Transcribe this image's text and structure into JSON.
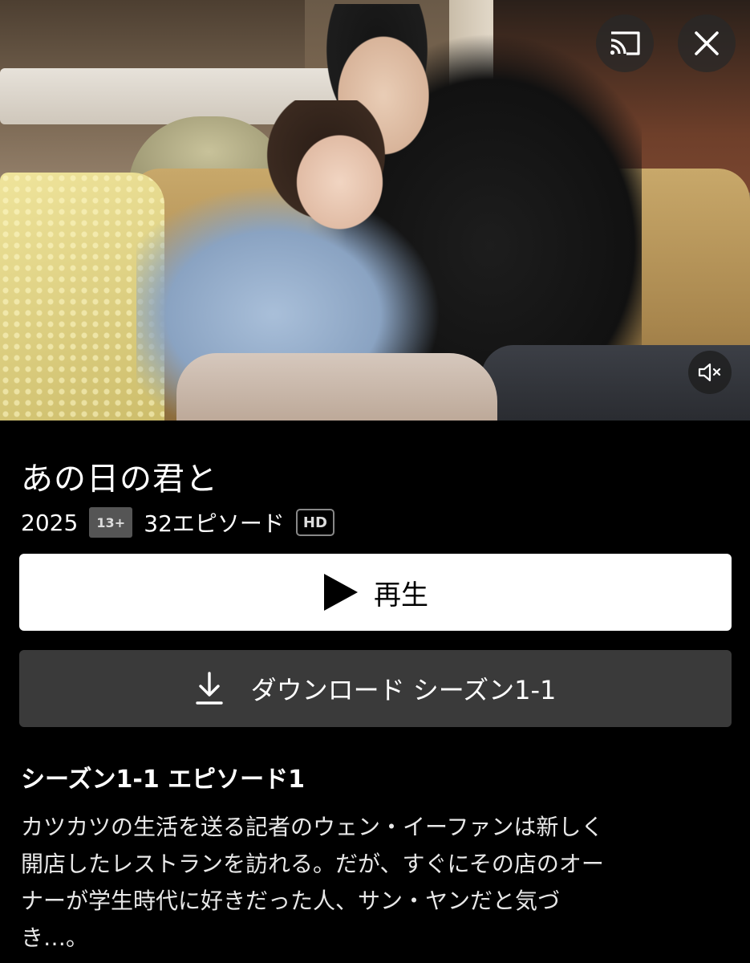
{
  "player": {
    "cast_icon": "cast-icon",
    "close_icon": "close-icon",
    "mute_icon": "muted-speaker-icon"
  },
  "show": {
    "title": "あの日の君と",
    "year": "2025",
    "rating": "13+",
    "episodes": "32エピソード",
    "quality": "HD"
  },
  "actions": {
    "play_label": "再生",
    "play_icon": "play-icon",
    "download_label": "ダウンロード シーズン1-1",
    "download_icon": "download-icon"
  },
  "episode": {
    "title": "シーズン1-1 エピソード1",
    "description_lines": [
      "カツカツの生活を送る記者のウェン・イーファンは新しく",
      "開店したレストランを訪れる。だが、すぐにその店のオー",
      "ナーが学生時代に好きだった人、サン・ヤンだと気づ",
      "き…。"
    ]
  },
  "colors": {
    "background": "#000000",
    "play_button_bg": "#ffffff",
    "download_button_bg": "#3a3a3a"
  }
}
